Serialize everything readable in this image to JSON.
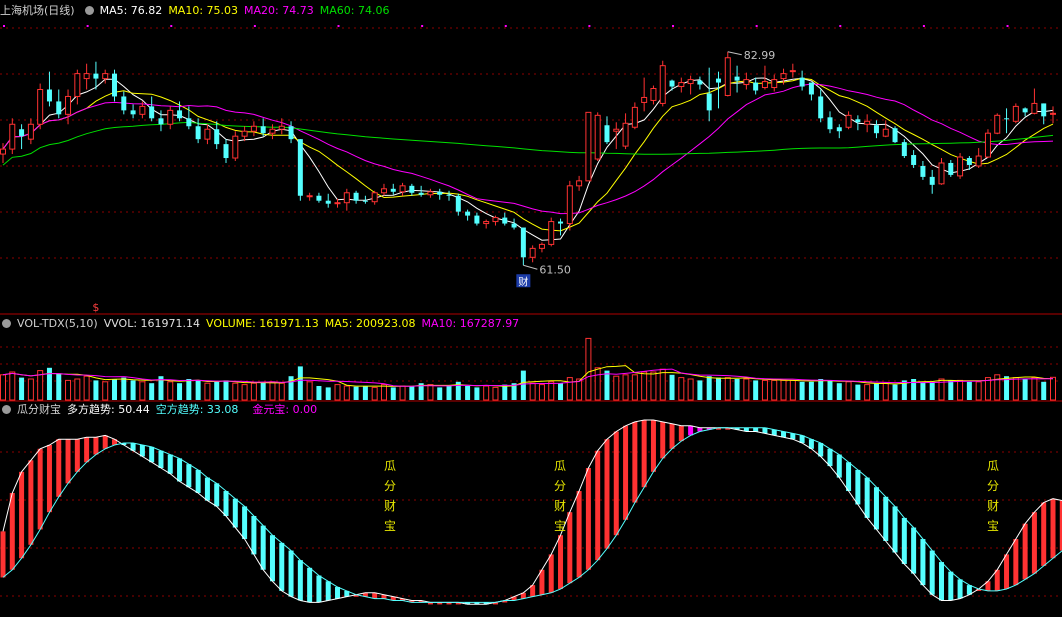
{
  "header_main": {
    "stock_name": "上海机场(日线)",
    "ma5": "MA5: 76.82",
    "ma10": "MA10: 75.03",
    "ma20": "MA20: 74.73",
    "ma60": "MA60: 74.06",
    "high_label": "82.99",
    "low_label": "61.50",
    "event_icon_caption": "财",
    "event_marker_caption": "$"
  },
  "header_volume": {
    "indicator": "VOL-TDX(5,10)",
    "vvol": "VVOL: 161971.14",
    "volume": "VOLUME: 161971.13",
    "ma5": "MA5: 200923.08",
    "ma10": "MA10: 167287.97"
  },
  "header_indicator": {
    "name": "瓜分财宝",
    "bull": "多方趋势: 50.44",
    "bear": "空方趋势: 33.08",
    "gold": "金元宝: 0.00"
  },
  "annotations": [
    "瓜分财宝",
    "瓜分财宝",
    "瓜分财宝"
  ],
  "colors": {
    "up": "#ff3232",
    "down": "#54ffff",
    "ma5": "#ffffff",
    "ma10": "#ffff00",
    "ma20": "#ff00ff",
    "ma60": "#00e000",
    "grid": "#8b0000",
    "magenta_bar": "#ff00ff"
  },
  "chart_data": {
    "type": "candlestick",
    "price_ylim": [
      58,
      86
    ],
    "candles": [
      [
        72.7,
        73.8,
        71.8,
        73.2
      ],
      [
        73.2,
        76.3,
        72.7,
        75.7
      ],
      [
        75.2,
        75.7,
        73.2,
        74.5
      ],
      [
        74.2,
        76.3,
        73.7,
        75.7
      ],
      [
        75.7,
        79.8,
        75.2,
        79.2
      ],
      [
        79.2,
        81.0,
        77.5,
        78.0
      ],
      [
        78.0,
        79.2,
        76.3,
        76.7
      ],
      [
        76.7,
        79.2,
        75.7,
        78.5
      ],
      [
        78.5,
        81.2,
        77.7,
        80.8
      ],
      [
        80.3,
        81.8,
        79.2,
        80.8
      ],
      [
        80.8,
        82.0,
        79.2,
        80.3
      ],
      [
        80.3,
        81.2,
        79.8,
        80.8
      ],
      [
        80.8,
        81.2,
        78.0,
        78.5
      ],
      [
        78.5,
        79.0,
        76.7,
        77.1
      ],
      [
        77.1,
        77.7,
        76.3,
        76.7
      ],
      [
        76.7,
        78.0,
        76.3,
        77.5
      ],
      [
        77.5,
        78.5,
        76.0,
        76.3
      ],
      [
        76.3,
        77.1,
        75.0,
        75.7
      ],
      [
        75.7,
        77.5,
        75.2,
        77.1
      ],
      [
        77.1,
        78.0,
        76.0,
        76.3
      ],
      [
        76.3,
        77.5,
        75.2,
        75.5
      ],
      [
        75.5,
        76.3,
        73.8,
        74.2
      ],
      [
        74.2,
        75.7,
        73.7,
        75.2
      ],
      [
        75.2,
        76.0,
        73.2,
        73.7
      ],
      [
        73.7,
        74.2,
        71.8,
        72.3
      ],
      [
        72.3,
        75.0,
        72.0,
        74.5
      ],
      [
        74.5,
        75.5,
        74.0,
        75.0
      ],
      [
        75.0,
        76.0,
        74.5,
        75.5
      ],
      [
        75.5,
        76.3,
        74.5,
        74.8
      ],
      [
        74.8,
        75.7,
        74.2,
        75.2
      ],
      [
        75.2,
        76.3,
        74.7,
        75.5
      ],
      [
        75.5,
        76.0,
        73.8,
        74.2
      ],
      [
        74.2,
        74.2,
        68.0,
        68.5
      ],
      [
        68.5,
        68.8,
        68.0,
        68.5
      ],
      [
        68.5,
        68.8,
        67.8,
        68.0
      ],
      [
        68.0,
        68.7,
        67.3,
        67.7
      ],
      [
        67.7,
        68.2,
        67.3,
        67.8
      ],
      [
        67.8,
        69.2,
        67.0,
        68.8
      ],
      [
        68.8,
        69.0,
        67.7,
        68.0
      ],
      [
        68.0,
        68.5,
        67.7,
        67.9
      ],
      [
        67.9,
        69.0,
        67.6,
        68.8
      ],
      [
        68.8,
        69.7,
        68.5,
        69.2
      ],
      [
        69.2,
        69.7,
        68.6,
        68.9
      ],
      [
        68.9,
        69.8,
        68.5,
        69.5
      ],
      [
        69.5,
        69.7,
        68.5,
        68.8
      ],
      [
        68.8,
        69.5,
        68.4,
        68.6
      ],
      [
        68.6,
        69.2,
        68.3,
        68.9
      ],
      [
        68.9,
        69.2,
        68.1,
        68.6
      ],
      [
        68.6,
        69.0,
        68.0,
        68.5
      ],
      [
        68.5,
        68.7,
        66.5,
        66.9
      ],
      [
        66.9,
        67.1,
        66.0,
        66.5
      ],
      [
        66.5,
        66.8,
        65.5,
        65.7
      ],
      [
        65.7,
        66.1,
        65.2,
        65.9
      ],
      [
        65.9,
        66.5,
        65.5,
        66.3
      ],
      [
        66.3,
        66.8,
        65.5,
        65.7
      ],
      [
        65.7,
        66.2,
        65.1,
        65.3
      ],
      [
        65.3,
        65.3,
        61.5,
        62.3
      ],
      [
        62.3,
        63.5,
        61.8,
        63.2
      ],
      [
        63.2,
        63.8,
        62.8,
        63.6
      ],
      [
        63.6,
        66.3,
        63.4,
        65.9
      ],
      [
        65.9,
        66.2,
        64.5,
        65.7
      ],
      [
        65.7,
        70.0,
        65.0,
        69.5
      ],
      [
        69.5,
        70.5,
        69.0,
        70.0
      ],
      [
        70.0,
        76.9,
        70.0,
        76.9
      ],
      [
        72.2,
        76.9,
        72.0,
        76.6
      ],
      [
        75.6,
        76.5,
        73.7,
        73.9
      ],
      [
        75.0,
        75.9,
        73.2,
        75.2
      ],
      [
        73.5,
        76.8,
        73.2,
        75.8
      ],
      [
        75.4,
        77.9,
        75.2,
        77.4
      ],
      [
        77.9,
        80.4,
        77.0,
        78.4
      ],
      [
        78.1,
        79.6,
        77.7,
        79.3
      ],
      [
        77.8,
        82.1,
        77.5,
        81.6
      ],
      [
        80.1,
        80.2,
        79.1,
        79.5
      ],
      [
        79.5,
        80.4,
        78.9,
        79.9
      ],
      [
        79.8,
        80.6,
        78.7,
        80.2
      ],
      [
        80.1,
        80.5,
        79.2,
        79.7
      ],
      [
        78.8,
        81.4,
        76.0,
        77.1
      ],
      [
        80.3,
        81.0,
        77.3,
        79.9
      ],
      [
        78.6,
        83.0,
        78.5,
        82.4
      ],
      [
        80.5,
        81.6,
        78.9,
        80.1
      ],
      [
        79.7,
        80.9,
        79.2,
        80.2
      ],
      [
        79.9,
        80.4,
        78.7,
        79.1
      ],
      [
        79.4,
        81.6,
        79.2,
        80.0
      ],
      [
        79.4,
        80.7,
        79.0,
        80.2
      ],
      [
        80.3,
        81.3,
        79.7,
        80.8
      ],
      [
        81.1,
        81.8,
        80.4,
        81.1
      ],
      [
        80.4,
        81.1,
        79.1,
        79.5
      ],
      [
        79.9,
        79.9,
        78.1,
        78.7
      ],
      [
        78.5,
        79.2,
        75.9,
        76.3
      ],
      [
        76.4,
        77.0,
        74.8,
        75.2
      ],
      [
        75.4,
        75.7,
        74.3,
        75.0
      ],
      [
        75.4,
        77.0,
        75.2,
        76.6
      ],
      [
        76.2,
        76.6,
        75.1,
        75.9
      ],
      [
        75.7,
        76.7,
        74.9,
        76.0
      ],
      [
        75.6,
        76.1,
        74.3,
        74.8
      ],
      [
        74.5,
        76.1,
        74.4,
        75.2
      ],
      [
        75.3,
        75.5,
        73.8,
        73.9
      ],
      [
        73.9,
        74.2,
        72.3,
        72.5
      ],
      [
        72.6,
        73.1,
        71.3,
        71.6
      ],
      [
        71.5,
        72.0,
        70.1,
        70.4
      ],
      [
        70.4,
        71.1,
        68.7,
        69.6
      ],
      [
        69.7,
        72.3,
        69.6,
        71.8
      ],
      [
        71.8,
        72.1,
        70.4,
        70.6
      ],
      [
        70.5,
        72.8,
        70.2,
        72.4
      ],
      [
        72.3,
        72.5,
        71.1,
        71.6
      ],
      [
        71.5,
        73.3,
        71.3,
        72.5
      ],
      [
        72.4,
        75.2,
        72.3,
        74.8
      ],
      [
        74.8,
        76.8,
        74.7,
        76.6
      ],
      [
        76.3,
        77.3,
        74.8,
        76.2
      ],
      [
        76.0,
        77.8,
        75.8,
        77.5
      ],
      [
        77.3,
        77.4,
        76.5,
        76.9
      ],
      [
        76.8,
        79.3,
        76.7,
        77.8
      ],
      [
        77.8,
        77.8,
        75.7,
        76.5
      ],
      [
        76.8,
        77.5,
        75.8,
        76.8
      ]
    ],
    "volume_ylim": [
      0,
      500000
    ],
    "volume": [
      180000,
      200000,
      160000,
      150000,
      210000,
      230000,
      190000,
      140000,
      150000,
      170000,
      140000,
      130000,
      150000,
      160000,
      140000,
      130000,
      120000,
      170000,
      130000,
      120000,
      150000,
      140000,
      120000,
      130000,
      140000,
      120000,
      110000,
      120000,
      130000,
      130000,
      120000,
      170000,
      240000,
      130000,
      100000,
      90000,
      110000,
      100000,
      95000,
      100000,
      90000,
      110000,
      90000,
      100000,
      100000,
      120000,
      110000,
      90000,
      100000,
      130000,
      100000,
      90000,
      100000,
      90000,
      110000,
      120000,
      210000,
      120000,
      110000,
      130000,
      120000,
      160000,
      150000,
      440000,
      230000,
      210000,
      170000,
      180000,
      180000,
      200000,
      200000,
      220000,
      180000,
      160000,
      150000,
      140000,
      170000,
      160000,
      160000,
      150000,
      150000,
      140000,
      140000,
      140000,
      140000,
      140000,
      130000,
      130000,
      150000,
      140000,
      120000,
      130000,
      110000,
      110000,
      120000,
      120000,
      110000,
      140000,
      150000,
      130000,
      130000,
      150000,
      140000,
      140000,
      130000,
      130000,
      160000,
      180000,
      170000,
      160000,
      150000,
      160000,
      130000,
      162000
    ],
    "indicator_ylim": [
      0,
      100
    ],
    "bull": [
      42,
      62,
      73,
      79,
      85,
      87,
      90,
      90,
      90,
      91,
      91,
      92,
      90,
      87,
      84,
      81,
      78,
      75,
      72,
      68,
      65,
      62,
      58,
      55,
      50,
      44,
      38,
      30,
      22,
      16,
      11,
      8,
      6,
      5,
      5,
      6,
      7,
      8,
      9,
      10,
      10,
      9,
      8,
      7,
      6,
      6,
      5,
      5,
      5,
      5,
      4,
      4,
      4,
      5,
      6,
      8,
      10,
      14,
      22,
      30,
      40,
      52,
      63,
      75,
      84,
      90,
      94,
      97,
      99,
      100,
      100,
      99,
      98,
      97,
      97,
      96,
      96,
      96,
      96,
      95,
      94,
      94,
      93,
      92,
      91,
      90,
      88,
      85,
      81,
      76,
      70,
      63,
      56,
      49,
      43,
      37,
      31,
      25,
      20,
      14,
      9,
      6,
      6,
      7,
      9,
      12,
      16,
      22,
      30,
      38,
      46,
      52,
      57,
      59,
      58,
      56
    ],
    "bear": [
      18,
      22,
      28,
      35,
      43,
      52,
      60,
      67,
      73,
      78,
      82,
      85,
      87,
      88,
      88,
      87,
      86,
      84,
      82,
      80,
      77,
      74,
      70,
      67,
      63,
      59,
      55,
      50,
      45,
      40,
      36,
      32,
      27,
      23,
      19,
      16,
      13,
      11,
      9,
      8,
      7,
      7,
      6,
      6,
      5,
      5,
      5,
      5,
      5,
      5,
      5,
      5,
      5,
      5,
      6,
      6,
      7,
      8,
      9,
      10,
      12,
      15,
      18,
      22,
      27,
      33,
      40,
      48,
      57,
      65,
      73,
      80,
      85,
      89,
      92,
      94,
      95,
      96,
      96,
      96,
      96,
      96,
      96,
      95,
      94,
      93,
      92,
      90,
      88,
      85,
      82,
      78,
      74,
      70,
      65,
      60,
      55,
      49,
      44,
      38,
      32,
      26,
      21,
      17,
      14,
      12,
      11,
      11,
      12,
      14,
      17,
      20,
      24,
      28,
      32,
      36
    ],
    "gold_signal_indices": [
      74,
      75,
      76
    ]
  }
}
